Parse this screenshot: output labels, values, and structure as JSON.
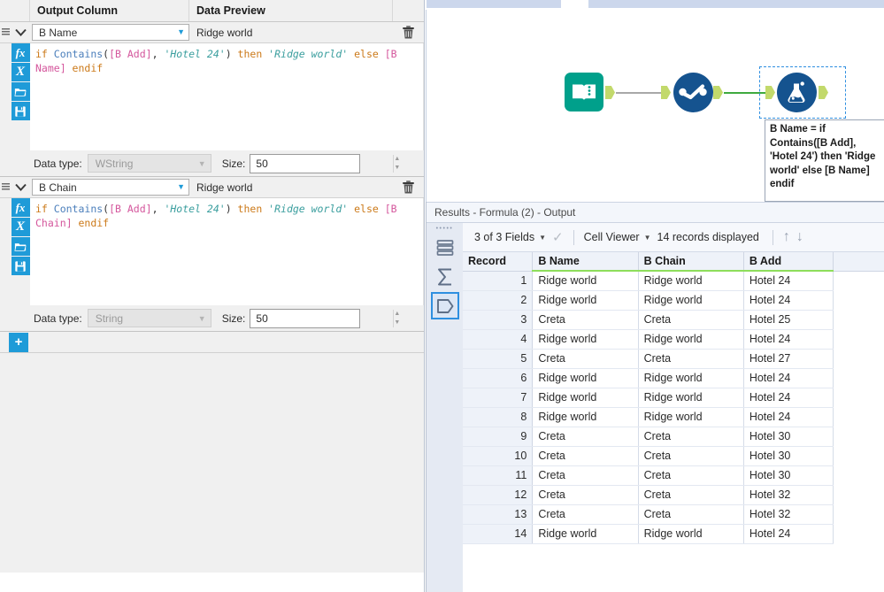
{
  "config_panel": {
    "headers": {
      "output_column": "Output Column",
      "data_preview": "Data Preview"
    },
    "formulas": [
      {
        "output_column": "B Name",
        "preview": "Ridge world",
        "expression_tokens": [
          {
            "t": "if ",
            "c": "kw"
          },
          {
            "t": "Contains",
            "c": "fn"
          },
          {
            "t": "(",
            "c": "pl"
          },
          {
            "t": "[B Add]",
            "c": "fld"
          },
          {
            "t": ", ",
            "c": "pl"
          },
          {
            "t": "'Hotel 24'",
            "c": "str"
          },
          {
            "t": ")",
            "c": "pl"
          },
          {
            "t": " then ",
            "c": "kw"
          },
          {
            "t": "'Ridge world'",
            "c": "str"
          },
          {
            "t": " else ",
            "c": "kw"
          },
          {
            "t": "[B Name]",
            "c": "fld"
          },
          {
            "t": " endif",
            "c": "kw"
          }
        ],
        "data_type_label": "Data type:",
        "data_type": "WString",
        "size_label": "Size:",
        "size": "50"
      },
      {
        "output_column": "B Chain",
        "preview": "Ridge world",
        "expression_tokens": [
          {
            "t": "if ",
            "c": "kw"
          },
          {
            "t": "Contains",
            "c": "fn"
          },
          {
            "t": "(",
            "c": "pl"
          },
          {
            "t": "[B Add]",
            "c": "fld"
          },
          {
            "t": ", ",
            "c": "pl"
          },
          {
            "t": "'Hotel 24'",
            "c": "str"
          },
          {
            "t": ")",
            "c": "pl"
          },
          {
            "t": " then ",
            "c": "kw"
          },
          {
            "t": "'Ridge world'",
            "c": "str"
          },
          {
            "t": " else ",
            "c": "kw"
          },
          {
            "t": "[B Chain]",
            "c": "fld"
          },
          {
            "t": " endif",
            "c": "kw"
          }
        ],
        "data_type_label": "Data type:",
        "data_type": "String",
        "size_label": "Size:",
        "size": "50"
      }
    ],
    "add_button_label": "+",
    "editor_icons": [
      "fx-icon",
      "variable-icon",
      "open-folder-icon",
      "save-icon"
    ]
  },
  "canvas": {
    "nodes": [
      {
        "name": "input-data-tool",
        "icon": "book-icon"
      },
      {
        "name": "select-tool",
        "icon": "checkmark-circle-icon"
      },
      {
        "name": "formula-tool",
        "icon": "flask-icon",
        "selected": true
      }
    ],
    "annotation": "B Name = if Contains([B Add], 'Hotel 24') then 'Ridge world' else [B Name] endif"
  },
  "results": {
    "title": "Results - Formula (2) - Output",
    "toolbar": {
      "fields": "3 of 3 Fields",
      "viewer": "Cell Viewer",
      "records": "14 records displayed"
    },
    "rail_icons": [
      "records-stack-icon",
      "summary-sigma-icon",
      "metadata-tag-icon"
    ],
    "columns": [
      "Record",
      "B Name",
      "B Chain",
      "B Add"
    ],
    "rows": [
      {
        "record": "1",
        "b_name": "Ridge world",
        "b_chain": "Ridge world",
        "b_add": "Hotel 24"
      },
      {
        "record": "2",
        "b_name": "Ridge world",
        "b_chain": "Ridge world",
        "b_add": "Hotel 24"
      },
      {
        "record": "3",
        "b_name": "Creta",
        "b_chain": "Creta",
        "b_add": "Hotel 25"
      },
      {
        "record": "4",
        "b_name": "Ridge world",
        "b_chain": "Ridge world",
        "b_add": "Hotel 24"
      },
      {
        "record": "5",
        "b_name": "Creta",
        "b_chain": "Creta",
        "b_add": "Hotel 27"
      },
      {
        "record": "6",
        "b_name": "Ridge world",
        "b_chain": "Ridge world",
        "b_add": "Hotel 24"
      },
      {
        "record": "7",
        "b_name": "Ridge world",
        "b_chain": "Ridge world",
        "b_add": "Hotel 24"
      },
      {
        "record": "8",
        "b_name": "Ridge world",
        "b_chain": "Ridge world",
        "b_add": "Hotel 24"
      },
      {
        "record": "9",
        "b_name": "Creta",
        "b_chain": "Creta",
        "b_add": "Hotel 30"
      },
      {
        "record": "10",
        "b_name": "Creta",
        "b_chain": "Creta",
        "b_add": "Hotel 30"
      },
      {
        "record": "11",
        "b_name": "Creta",
        "b_chain": "Creta",
        "b_add": "Hotel 30"
      },
      {
        "record": "12",
        "b_name": "Creta",
        "b_chain": "Creta",
        "b_add": "Hotel 32"
      },
      {
        "record": "13",
        "b_name": "Creta",
        "b_chain": "Creta",
        "b_add": "Hotel 32"
      },
      {
        "record": "14",
        "b_name": "Ridge world",
        "b_chain": "Ridge world",
        "b_add": "Hotel 24"
      }
    ]
  },
  "colors": {
    "accent_blue": "#1f9bd8",
    "tool_teal": "#00a08b",
    "tool_blue": "#15538f",
    "anchor_green": "#c2d96b",
    "wire_green": "#3faa3f",
    "header_underline_green": "#8ede5b",
    "selection_blue": "#2f8fe0"
  }
}
